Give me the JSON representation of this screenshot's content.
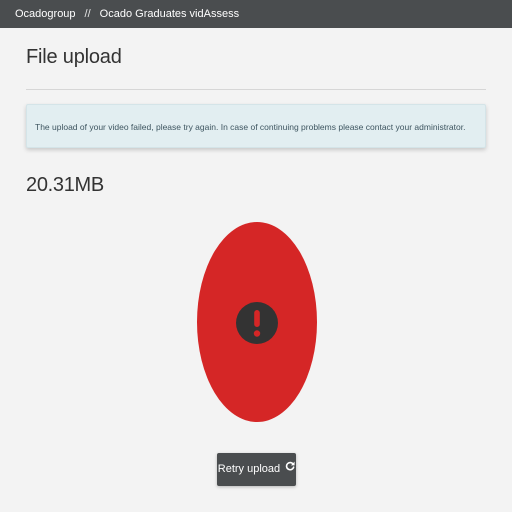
{
  "breadcrumb": {
    "items": [
      "Ocadogroup",
      "Ocado Graduates vidAssess"
    ],
    "separator": "//"
  },
  "page": {
    "title": "File upload"
  },
  "alert": {
    "message": "The upload of your video failed, please try again. In case of continuing problems please contact your administrator."
  },
  "file": {
    "size": "20.31MB"
  },
  "status": {
    "icon": "exclamation-circle-icon",
    "state": "error",
    "color": "#d52626"
  },
  "actions": {
    "retry_label": "Retry upload",
    "retry_icon": "refresh-icon"
  },
  "colors": {
    "topbar": "#4a4d4f",
    "alert_bg": "#e2eef1",
    "error": "#d52626",
    "button": "#4a4d4f"
  }
}
